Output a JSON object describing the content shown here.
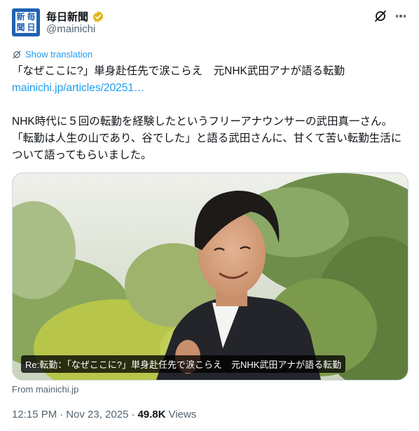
{
  "author": {
    "display_name": "毎日新聞",
    "handle": "@mainichi",
    "avatar_glyphs": [
      "新",
      "毎",
      "聞",
      "日"
    ],
    "verified_color": "#e2b719"
  },
  "actions": {
    "grok_icon": "grok-icon",
    "more_icon": "more-icon"
  },
  "translation": {
    "label": "Show translation"
  },
  "post": {
    "headline": "「なぜここに?」単身赴任先で涙こらえ　元NHK武田アナが語る転勤",
    "link": "mainichi.jp/articles/20251…",
    "body": "NHK時代に５回の転勤を経験したというフリーアナウンサーの武田真一さん。「転勤は人生の山であり、谷でした」と語る武田さんに、甘くて苦い転勤生活について語ってもらいました。"
  },
  "card": {
    "title": "Re:転勤：「なぜここに?」単身赴任先で涙こらえ　元NHK武田アナが語る転勤",
    "source": "From mainichi.jp"
  },
  "meta": {
    "time": "12:15 PM",
    "separator": "·",
    "date": "Nov 23, 2025",
    "views_count": "49.8K",
    "views_label": "Views"
  },
  "colors": {
    "link": "#1d9bf0",
    "secondary_text": "#536471",
    "avatar_bg": "#1f62b3"
  }
}
